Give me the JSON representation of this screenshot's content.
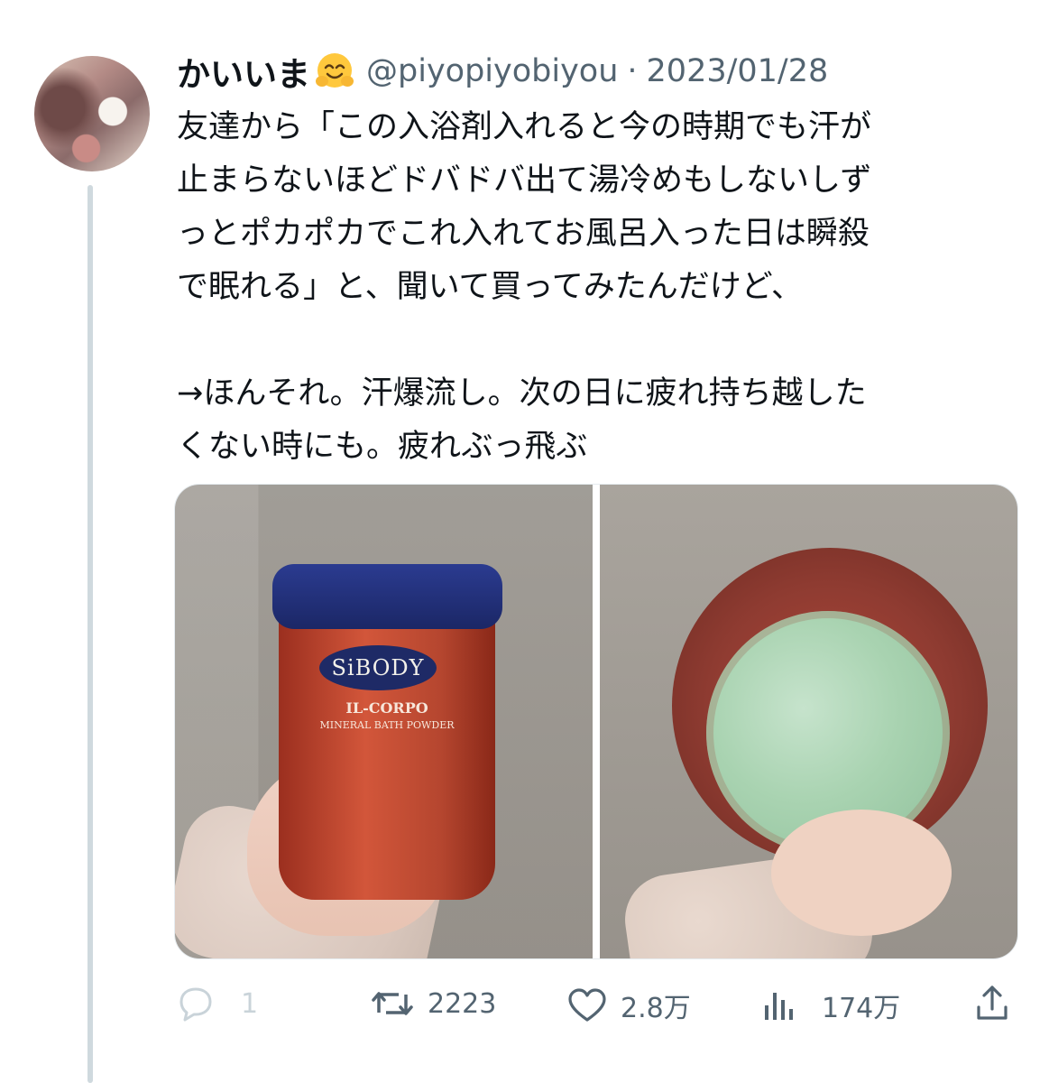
{
  "user": {
    "display_name": "かいいま",
    "handle": "@piyopiyobiyou",
    "separator": "·",
    "date": "2023/01/28"
  },
  "tweet": {
    "text": "友達から「この入浴剤入れると今の時期でも汗が\n止まらないほどドバドバ出て湯冷めもしないしず\nっとポカポカでこれ入れてお風呂入った日は瞬殺\nで眠れる」と、聞いて買ってみたんだけど、\n\n→ほんそれ。汗爆流し。次の日に疲れ持ち越した\nくない時にも。疲れぶっ飛ぶ"
  },
  "media": {
    "left_photo": {
      "brand": "SiBODY",
      "product": "IL-CORPO",
      "subtitle": "MINERAL BATH POWDER"
    }
  },
  "actions": {
    "reply_count": "1",
    "retweet_count": "2223",
    "like_count": "2.8万",
    "views_count": "174万"
  },
  "colors": {
    "text": "#0f1419",
    "secondary": "#536471",
    "thread_line": "#cfd9de"
  }
}
